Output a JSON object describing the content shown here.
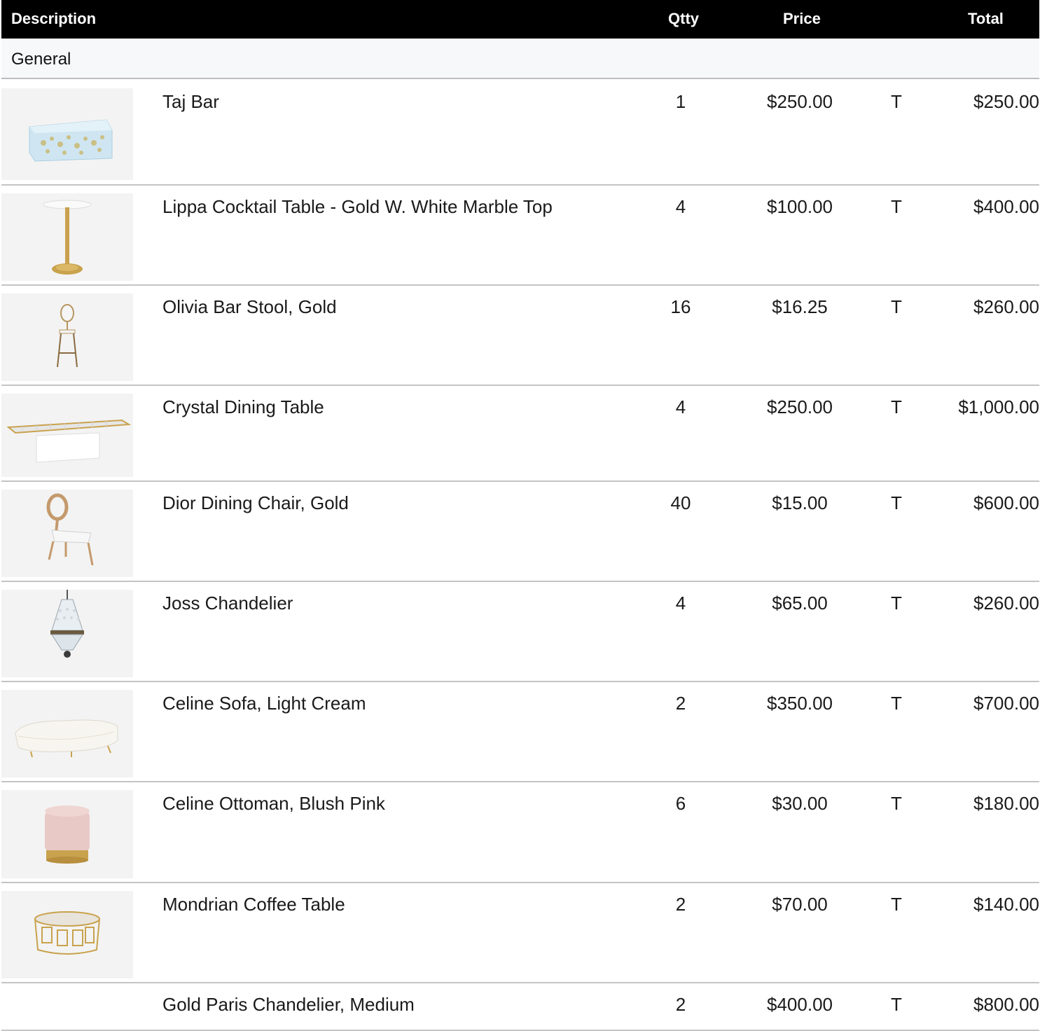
{
  "header": {
    "description": "Description",
    "qty": "Qtty",
    "price": "Price",
    "total": "Total"
  },
  "section": {
    "title": "General"
  },
  "items": [
    {
      "description": "Taj Bar",
      "qty": "1",
      "price": "$250.00",
      "tax": "T",
      "total": "$250.00",
      "image": "bar-image"
    },
    {
      "description": "Lippa Cocktail Table - Gold W. White Marble Top",
      "qty": "4",
      "price": "$100.00",
      "tax": "T",
      "total": "$400.00",
      "image": "cocktail-table-image"
    },
    {
      "description": "Olivia Bar Stool, Gold",
      "qty": "16",
      "price": "$16.25",
      "tax": "T",
      "total": "$260.00",
      "image": "bar-stool-image"
    },
    {
      "description": "Crystal Dining Table",
      "qty": "4",
      "price": "$250.00",
      "tax": "T",
      "total": "$1,000.00",
      "image": "dining-table-image"
    },
    {
      "description": "Dior Dining Chair, Gold",
      "qty": "40",
      "price": "$15.00",
      "tax": "T",
      "total": "$600.00",
      "image": "dining-chair-image"
    },
    {
      "description": "Joss Chandelier",
      "qty": "4",
      "price": "$65.00",
      "tax": "T",
      "total": "$260.00",
      "image": "chandelier-image"
    },
    {
      "description": "Celine Sofa, Light Cream",
      "qty": "2",
      "price": "$350.00",
      "tax": "T",
      "total": "$700.00",
      "image": "sofa-image"
    },
    {
      "description": "Celine Ottoman, Blush Pink",
      "qty": "6",
      "price": "$30.00",
      "tax": "T",
      "total": "$180.00",
      "image": "ottoman-image"
    },
    {
      "description": "Mondrian Coffee Table",
      "qty": "2",
      "price": "$70.00",
      "tax": "T",
      "total": "$140.00",
      "image": "coffee-table-image"
    },
    {
      "description": "Gold Paris Chandelier, Medium",
      "qty": "2",
      "price": "$400.00",
      "tax": "T",
      "total": "$800.00",
      "image": ""
    }
  ]
}
